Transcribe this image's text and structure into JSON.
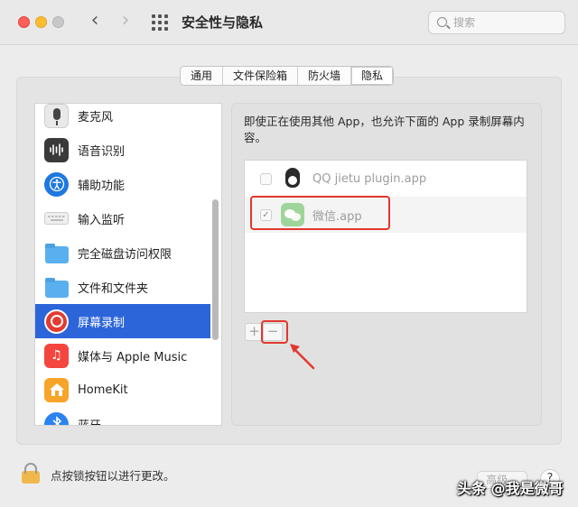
{
  "window": {
    "title": "安全性与隐私"
  },
  "search": {
    "placeholder": "搜索"
  },
  "tabs": [
    {
      "label": "通用",
      "active": false
    },
    {
      "label": "文件保险箱",
      "active": false
    },
    {
      "label": "防火墙",
      "active": false
    },
    {
      "label": "隐私",
      "active": true
    }
  ],
  "sidebar": {
    "items": [
      {
        "label": "麦克风",
        "icon": "microphone-icon",
        "selected": false
      },
      {
        "label": "语音识别",
        "icon": "speech-recognition-icon",
        "selected": false
      },
      {
        "label": "辅助功能",
        "icon": "accessibility-icon",
        "selected": false
      },
      {
        "label": "输入监听",
        "icon": "keyboard-icon",
        "selected": false
      },
      {
        "label": "完全磁盘访问权限",
        "icon": "folder-icon",
        "selected": false
      },
      {
        "label": "文件和文件夹",
        "icon": "folder-icon",
        "selected": false
      },
      {
        "label": "屏幕录制",
        "icon": "screen-recording-icon",
        "selected": true
      },
      {
        "label": "媒体与 Apple Music",
        "icon": "music-icon",
        "selected": false
      },
      {
        "label": "HomeKit",
        "icon": "home-icon",
        "selected": false
      },
      {
        "label": "蓝牙",
        "icon": "bluetooth-icon",
        "selected": false
      }
    ]
  },
  "detail": {
    "description": "即使正在使用其他 App，也允许下面的 App 录制屏幕内容。",
    "apps": [
      {
        "name": "QQ jietu plugin.app",
        "checked": false,
        "icon": "qq-penguin-icon"
      },
      {
        "name": "微信.app",
        "checked": true,
        "icon": "wechat-icon"
      }
    ],
    "add_label": "+",
    "remove_label": "−"
  },
  "footer": {
    "lock_text": "点按锁按钮以进行更改。",
    "advanced_label": "高级...",
    "help_label": "?"
  },
  "watermark": "头条 @我是微哥",
  "colors": {
    "selection": "#2c64d9",
    "annotation": "#e2372f"
  }
}
